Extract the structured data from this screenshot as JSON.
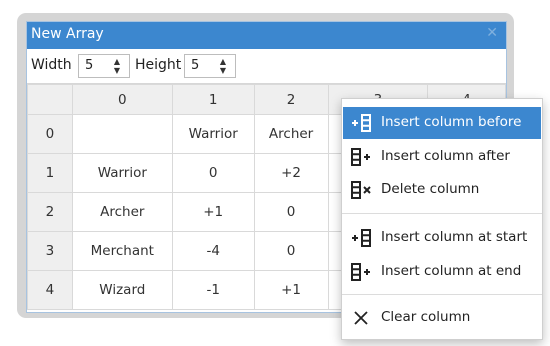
{
  "window": {
    "title": "New Array",
    "close_glyph": "✕"
  },
  "toolbar": {
    "width_label": "Width",
    "width_value": "5",
    "height_label": "Height",
    "height_value": "5"
  },
  "grid": {
    "col_headers": [
      "0",
      "1",
      "2",
      "3",
      "4"
    ],
    "rows": [
      {
        "header": "0",
        "cells": [
          "",
          "Warrior",
          "Archer",
          "",
          ""
        ]
      },
      {
        "header": "1",
        "cells": [
          "Warrior",
          "0",
          "+2",
          "",
          ""
        ]
      },
      {
        "header": "2",
        "cells": [
          "Archer",
          "+1",
          "0",
          "",
          ""
        ]
      },
      {
        "header": "3",
        "cells": [
          "Merchant",
          "-4",
          "0",
          "",
          ""
        ]
      },
      {
        "header": "4",
        "cells": [
          "Wizard",
          "-1",
          "+1",
          "",
          ""
        ]
      }
    ]
  },
  "context_menu": {
    "items": [
      {
        "label": "Insert column before",
        "icon": "insert-column-before-icon"
      },
      {
        "label": "Insert column after",
        "icon": "insert-column-after-icon"
      },
      {
        "label": "Delete column",
        "icon": "delete-column-icon"
      },
      {
        "label": "Insert column at start",
        "icon": "insert-column-start-icon"
      },
      {
        "label": "Insert column at end",
        "icon": "insert-column-end-icon"
      },
      {
        "label": "Clear column",
        "icon": "clear-icon"
      }
    ]
  },
  "colors": {
    "accent": "#3c87cf",
    "header_bg": "#efefef"
  }
}
